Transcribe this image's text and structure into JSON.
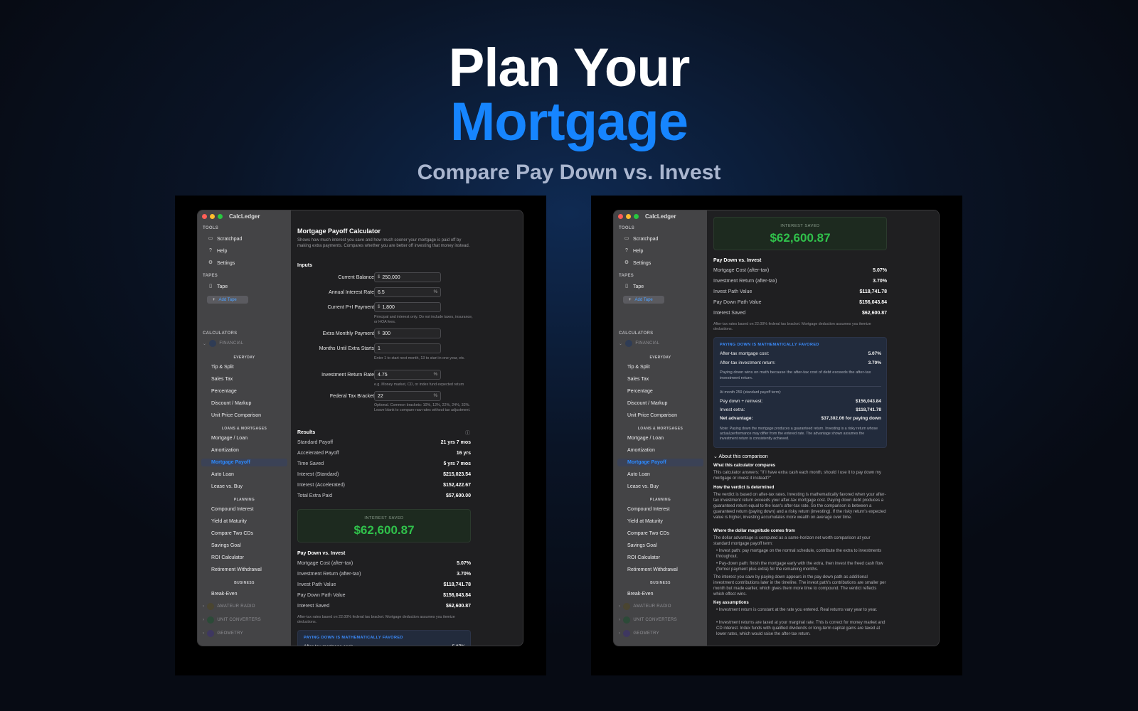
{
  "hero": {
    "line1": "Plan Your",
    "line2": "Mortgage",
    "subtitle": "Compare Pay Down vs. Invest"
  },
  "app": {
    "title": "CalcLedger",
    "sidebar": {
      "tools_label": "TOOLS",
      "tools": [
        "Scratchpad",
        "Help",
        "Settings"
      ],
      "tapes_label": "TAPES",
      "tape": "Tape",
      "add_tape": "Add Tape",
      "calculators_label": "CALCULATORS",
      "financial": "FINANCIAL",
      "everyday_label": "EVERYDAY",
      "everyday": [
        "Tip & Split",
        "Sales Tax",
        "Percentage",
        "Discount / Markup",
        "Unit Price Comparison"
      ],
      "loans_label": "LOANS & MORTGAGES",
      "loans": [
        "Mortgage / Loan",
        "Amortization",
        "Mortgage Payoff",
        "Auto Loan",
        "Lease vs. Buy"
      ],
      "planning_label": "PLANNING",
      "planning": [
        "Compound Interest",
        "Yield at Maturity",
        "Compare Two CDs",
        "Savings Goal",
        "ROI Calculator",
        "Retirement Withdrawal"
      ],
      "business_label": "BUSINESS",
      "business": [
        "Break-Even"
      ],
      "groups": [
        "AMATEUR RADIO",
        "UNIT CONVERTERS",
        "GEOMETRY"
      ]
    },
    "page": {
      "title": "Mortgage Payoff Calculator",
      "description": "Shows how much interest you save and how much sooner your mortgage is paid off by making extra payments. Compares whether you are better off investing that money instead.",
      "inputs_label": "Inputs",
      "fields": [
        {
          "label": "Current Balance",
          "prefix": "$",
          "value": "250,000",
          "suffix": "",
          "help": ""
        },
        {
          "label": "Annual Interest Rate",
          "prefix": "",
          "value": "6.5",
          "suffix": "%",
          "help": ""
        },
        {
          "label": "Current P+I Payment",
          "prefix": "$",
          "value": "1,800",
          "suffix": "",
          "help": "Principal and interest only. Do not include taxes, insurance, or HOA fees."
        },
        {
          "label": "Extra Monthly Payment",
          "prefix": "$",
          "value": "300",
          "suffix": "",
          "help": ""
        },
        {
          "label": "Months Until Extra Starts",
          "prefix": "",
          "value": "1",
          "suffix": "",
          "help": "Enter 1 to start next month, 13 to start in one year, etc."
        },
        {
          "label": "Investment Return Rate",
          "prefix": "",
          "value": "4.75",
          "suffix": "%",
          "help": "e.g. Money market, CD, or index fund expected return"
        },
        {
          "label": "Federal Tax Bracket",
          "prefix": "",
          "value": "22",
          "suffix": "%",
          "help": "Optional. Common brackets: 10%, 12%, 22%, 24%, 32%. Leave blank to compare raw rates without tax adjustment."
        }
      ],
      "results_label": "Results",
      "results": [
        {
          "label": "Standard Payoff",
          "value": "21 yrs 7 mos"
        },
        {
          "label": "Accelerated Payoff",
          "value": "16 yrs"
        },
        {
          "label": "Time Saved",
          "value": "5 yrs 7 mos"
        },
        {
          "label": "Interest (Standard)",
          "value": "$215,023.54"
        },
        {
          "label": "Interest (Accelerated)",
          "value": "$152,422.67"
        },
        {
          "label": "Total Extra Paid",
          "value": "$57,600.00"
        }
      ],
      "saved_label": "INTEREST SAVED",
      "saved_value": "$62,600.87",
      "pdi_label": "Pay Down vs. Invest",
      "pdi": [
        {
          "label": "Mortgage Cost (after-tax)",
          "value": "5.07%"
        },
        {
          "label": "Investment Return (after-tax)",
          "value": "3.70%"
        },
        {
          "label": "Invest Path Value",
          "value": "$118,741.78"
        },
        {
          "label": "Pay Down Path Value",
          "value": "$156,043.84"
        },
        {
          "label": "Interest Saved",
          "value": "$62,600.87"
        }
      ],
      "pdi_note": "After-tax rates based on 22.00% federal tax bracket. Mortgage deduction assumes you itemize deductions.",
      "verdict": {
        "title": "PAYING DOWN IS MATHEMATICALLY FAVORED",
        "rows1": [
          {
            "label": "After-tax mortgage cost:",
            "value": "5.07%"
          },
          {
            "label": "After-tax investment return:",
            "value": "3.70%"
          }
        ],
        "explain": "Paying down wins on math because the after-tax cost of debt exceeds the after-tax investment return.",
        "horizon": "At month 259 (standard payoff term):",
        "rows2": [
          {
            "label": "Pay down + reinvest:",
            "value": "$156,043.84"
          },
          {
            "label": "Invest extra:",
            "value": "$118,741.78"
          },
          {
            "label": "Net advantage:",
            "value": "$37,302.06 for paying down"
          }
        ],
        "note": "Note: Paying down the mortgage produces a guaranteed return. Investing is a risky return whose actual performance may differ from the entered rate. The advantage shown assumes the investment return is consistently achieved."
      },
      "about": {
        "toggle": "About this comparison",
        "h1": "What this calculator compares",
        "t1": "This calculator answers: \"If I have extra cash each month, should I use it to pay down my mortgage or invest it instead?\"",
        "h2": "How the verdict is determined",
        "t2": "The verdict is based on after-tax rates. Investing is mathematically favored when your after-tax investment return exceeds your after-tax mortgage cost. Paying down debt produces a guaranteed return equal to the loan's after-tax rate. So the comparison is between a guaranteed return (paying down) and a risky return (investing). If the risky return's expected value is higher, investing accumulates more wealth on average over time.",
        "h3": "Where the dollar magnitude comes from",
        "t3": "The dollar advantage is computed as a same-horizon net worth comparison at your standard mortgage payoff term:",
        "b1": "• Invest path: pay mortgage on the normal schedule, contribute the extra to investments throughout.",
        "b2": "• Pay-down path: finish the mortgage early with the extra, then invest the freed cash flow (former payment plus extra) for the remaining months.",
        "t4": "The interest you save by paying down appears in the pay-down path as additional investment contributions later in the timeline. The invest path's contributions are smaller per month but made earlier, which gives them more time to compound. The verdict reflects which effect wins.",
        "h4": "Key assumptions",
        "b3": "• Investment return is constant at the rate you entered. Real returns vary year to year.",
        "b4": "• Investment returns are taxed at your marginal rate. This is correct for money market and CD interest. Index funds with qualified dividends or long-term capital gains are taxed at lower rates, which would raise the after-tax return."
      }
    }
  }
}
